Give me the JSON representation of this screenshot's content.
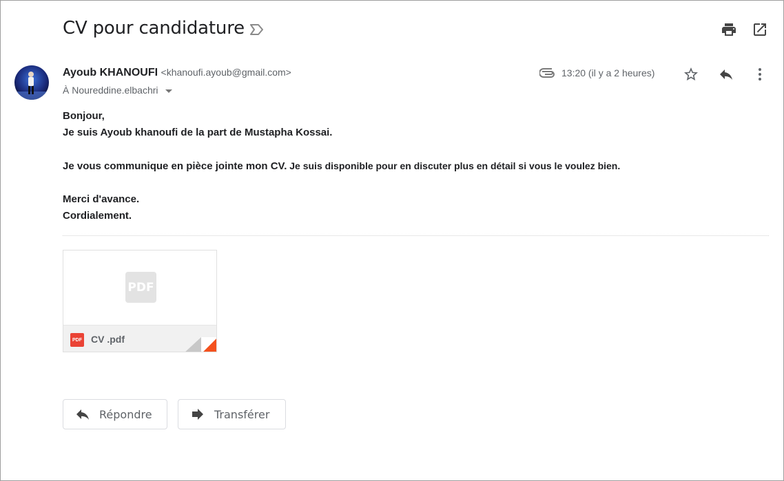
{
  "email": {
    "subject": "CV pour candidature",
    "sender_name": "Ayoub KHANOUFI",
    "sender_email": "<khanoufi.ayoub@gmail.com>",
    "recipient": "À Noureddine.elbachri",
    "time": "13:20 (il y a 2 heures)",
    "body": {
      "greeting": "Bonjour,",
      "intro": "Je suis Ayoub khanoufi de la part de Mustapha Kossai.",
      "line1_bold": "Je vous communique en pièce jointe mon CV.",
      "line1_rest": " Je suis disponible pour en discuter plus en détail si vous le voulez bien.",
      "thanks": "Merci d'avance.",
      "closing": "Cordialement."
    },
    "attachment": {
      "preview_label": "PDF",
      "type_badge": "PDF",
      "filename": "CV .pdf"
    }
  },
  "actions": {
    "reply_label": "Répondre",
    "forward_label": "Transférer"
  },
  "icons": {
    "label": "label-outline-icon",
    "print": "print-icon",
    "open_new_window": "open-in-new-icon",
    "attachment": "paperclip-icon",
    "star": "star-outline-icon",
    "reply": "reply-icon",
    "more": "more-vertical-icon",
    "forward": "forward-icon"
  },
  "colors": {
    "text": "#202124",
    "muted": "#5f6368",
    "pdf_red": "#ea4335",
    "fold_red": "#f4511e"
  }
}
